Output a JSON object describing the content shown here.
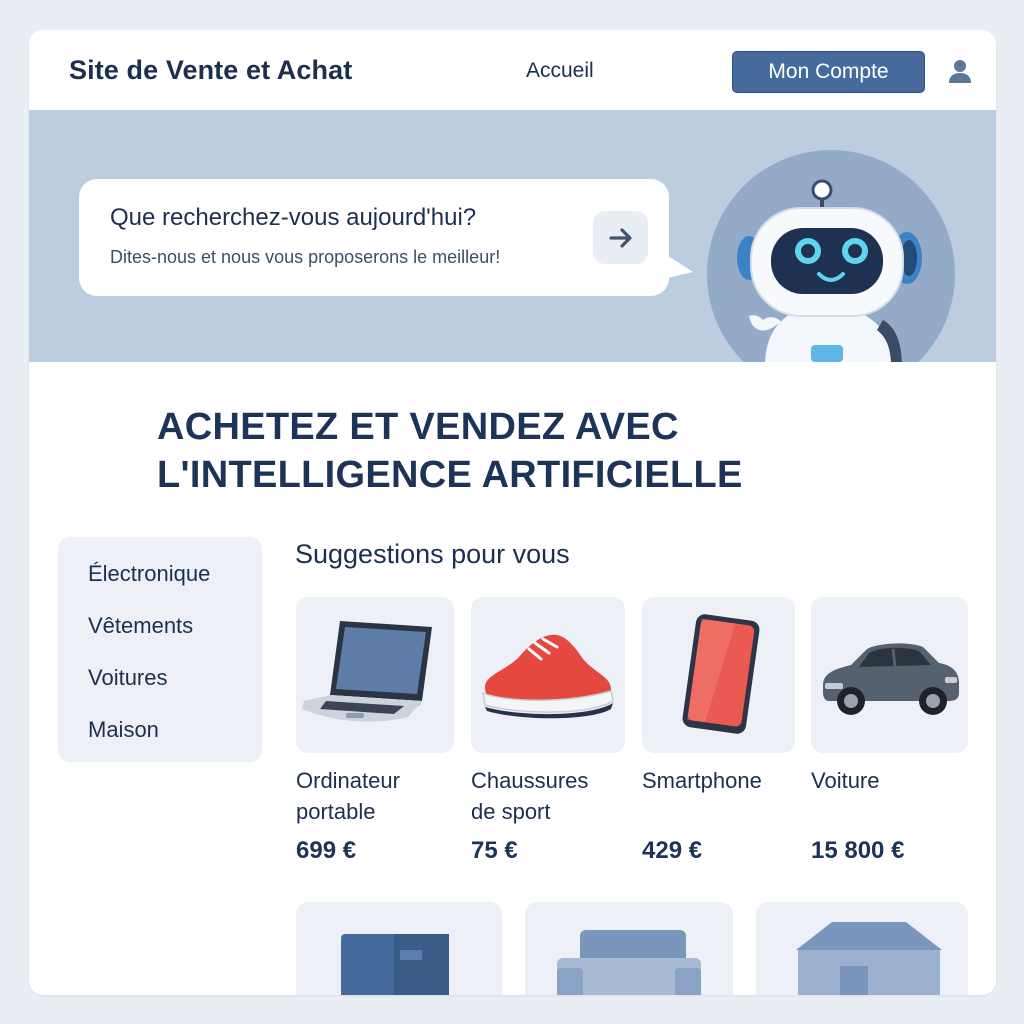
{
  "header": {
    "site_title": "Site de Vente et Achat",
    "nav_home": "Accueil",
    "account_button": "Mon Compte",
    "user_icon": "user-icon"
  },
  "hero": {
    "question": "Que recherchez-vous aujourd'hui?",
    "subtitle": "Dites-nous et nous vous proposerons le meilleur!",
    "arrow_icon": "arrow-right-icon",
    "mascot": "robot-illustration"
  },
  "headline": {
    "line1": "ACHETEZ ET VENDEZ AVEC",
    "line2": "L'INTELLIGENCE ARTIFICIELLE"
  },
  "sidebar": {
    "categories": [
      {
        "label": "Électronique"
      },
      {
        "label": "Vêtements"
      },
      {
        "label": "Voitures"
      },
      {
        "label": "Maison"
      }
    ]
  },
  "suggestions": {
    "title": "Suggestions pour vous",
    "products": [
      {
        "name_line1": "Ordinateur",
        "name_line2": "portable",
        "price": "699 €",
        "icon": "laptop-icon"
      },
      {
        "name_line1": "Chaussures",
        "name_line2": "de sport",
        "price": "75 €",
        "icon": "sneaker-icon"
      },
      {
        "name_line1": "Smartphone",
        "name_line2": "",
        "price": "429 €",
        "icon": "smartphone-icon"
      },
      {
        "name_line1": "Voiture",
        "name_line2": "",
        "price": "15 800 €",
        "icon": "car-icon"
      }
    ],
    "more_items": [
      "box-icon",
      "sofa-icon",
      "house-icon"
    ]
  },
  "colors": {
    "page_bg": "#e9edf4",
    "hero_bg": "#bdcde0",
    "primary": "#456b9c",
    "text_dark": "#1d2f4f",
    "card_bg": "#edf1f7",
    "accent_red": "#e5483f"
  }
}
